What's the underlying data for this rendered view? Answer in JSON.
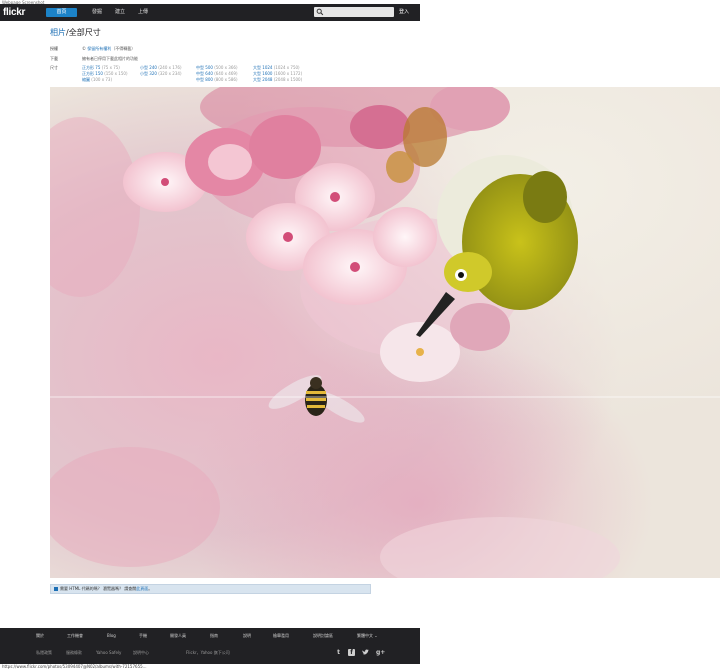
{
  "top_note": "Webpage Screenshot",
  "nav": {
    "logo": "flickr",
    "items": [
      "首頁",
      "發掘",
      "建立",
      "上傳"
    ],
    "login": "登入"
  },
  "title": {
    "link_text": "相片",
    "separator": "/",
    "rest": "全部尺寸"
  },
  "license": {
    "label": "授權",
    "value_link": "保留所有權利",
    "value_rest": "（不得轉載）"
  },
  "download": {
    "label": "下載",
    "value": "擁有者已停用下載此相片的功能"
  },
  "sizes": {
    "label": "尺寸",
    "items": [
      {
        "name": "正方形",
        "code": "75",
        "px": "(75 x 75)"
      },
      {
        "name": "正方形",
        "code": "150",
        "px": "(150 x 150)"
      },
      {
        "name": "縮圖",
        "code": "",
        "px": "(100 x 73)"
      },
      {
        "name": "小型",
        "code": "240",
        "px": "(240 x 176)"
      },
      {
        "name": "小型",
        "code": "320",
        "px": "(320 x 234)"
      },
      {
        "name": "中型",
        "code": "500",
        "px": "(500 x 366)"
      },
      {
        "name": "中型",
        "code": "640",
        "px": "(640 x 469)"
      },
      {
        "name": "中型",
        "code": "800",
        "px": "(800 x 586)"
      },
      {
        "name": "大型",
        "code": "1024",
        "px": "(1024 x 750)"
      },
      {
        "name": "大型",
        "code": "1600",
        "px": "(1600 x 1172)"
      },
      {
        "name": "大型",
        "code": "2048",
        "px": "(2048 x 1500)"
      }
    ]
  },
  "embed": {
    "text": "需要 HTML 代碼的嗎？ 瀏覽器嗎？ 請查閱",
    "link": "此頁面",
    "end": "。"
  },
  "footer": {
    "links": [
      "關於",
      "工作機會",
      "Blog",
      "手機",
      "開發人員",
      "指南",
      "說明",
      "檢舉濫用",
      "說明討論區",
      "繁體中文 ⌄"
    ],
    "bottom_links": [
      "私隱政策",
      "服務條款",
      "Yahoo Safely",
      "說明中心"
    ],
    "copyright": "Flickr，Yahoo 旗下公司",
    "social_icons": [
      "tumblr-icon",
      "facebook-icon",
      "twitter-icon",
      "google-plus-icon"
    ]
  },
  "status_url": "https://www.flickr.com/photos/53094407@N02/albums/with-72157655..."
}
